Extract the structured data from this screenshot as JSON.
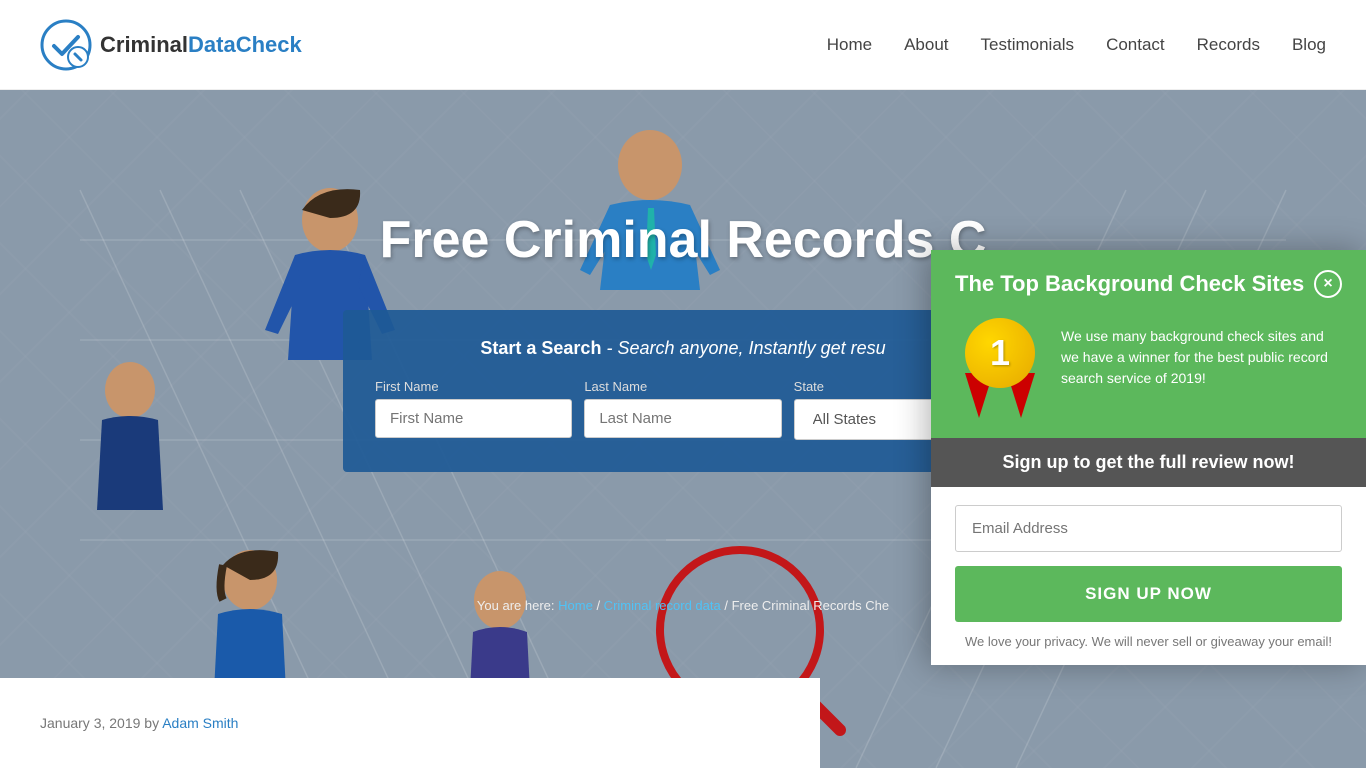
{
  "header": {
    "logo_criminal": "Criminal",
    "logo_data": "Data",
    "logo_check": "Check",
    "nav": {
      "home": "Home",
      "about": "About",
      "testimonials": "Testimonials",
      "contact": "Contact",
      "records": "Records",
      "blog": "Blog"
    }
  },
  "hero": {
    "title": "Free Criminal Records C",
    "search_label": "Start a Search",
    "search_tagline": "- Search anyone, Instantly get resu",
    "fields": {
      "first_name_label": "First Name",
      "first_name_placeholder": "First Name",
      "last_name_label": "Last Name",
      "last_name_placeholder": "Last Name",
      "state_label": "State",
      "state_default": "All States"
    }
  },
  "breadcrumb": {
    "you_are_here": "You are here:",
    "home": "Home",
    "criminal_record_data": "Criminal record data",
    "current": "Free Criminal Records Che"
  },
  "post_meta": {
    "date": "January 3, 2019",
    "by": "by",
    "author": "Adam Smith"
  },
  "popup": {
    "title": "The Top Background Check Sites",
    "badge_number": "1",
    "badge_text": "We use many background check sites and we have a winner for the best public record search service of 2019!",
    "signup_bar": "Sign up to get the full review now!",
    "email_placeholder": "Email Address",
    "button_label": "SIGN UP NOW",
    "privacy_text": "We love your privacy.  We will never sell or giveaway your email!",
    "close_label": "×"
  }
}
